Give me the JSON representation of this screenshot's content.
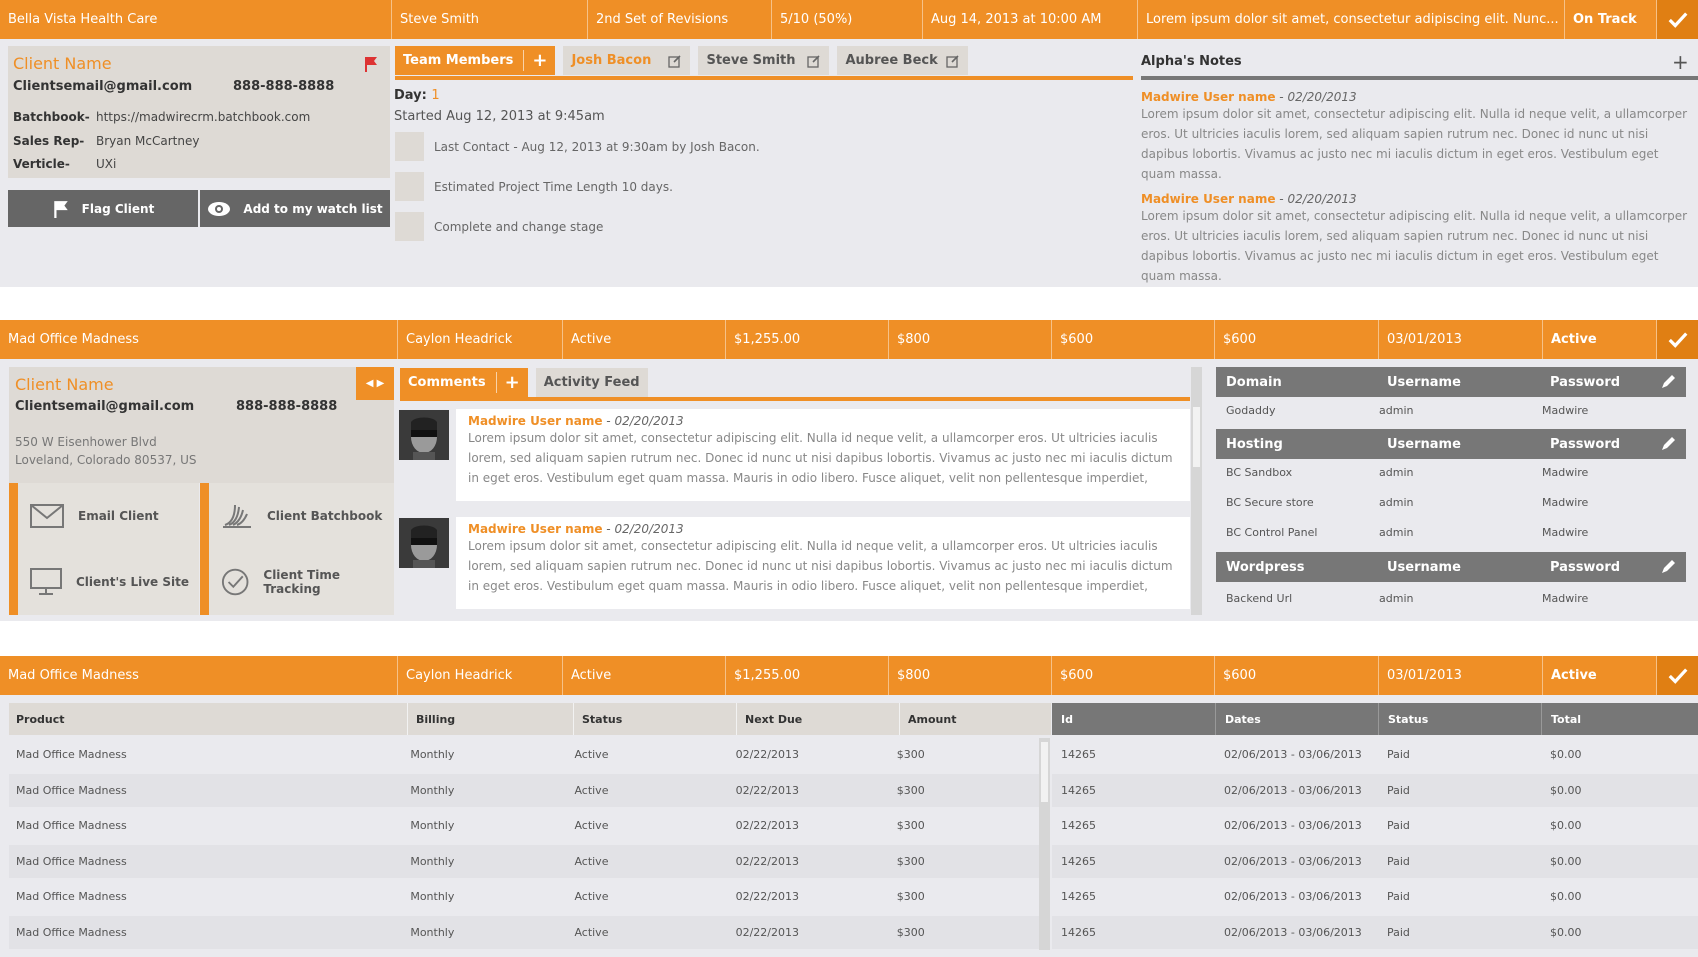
{
  "colors": {
    "accent": "#ef8f26",
    "accent_dark": "#e07f13",
    "dark_gray": "#777777",
    "panel": "#eaeaee",
    "card": "#dedad5"
  },
  "top_bar": {
    "client": "Bella Vista Health Care",
    "person": "Steve Smith",
    "revision": "2nd Set of Revisions",
    "progress_text": "5/10 (50%)",
    "progress": 0.5,
    "date": "Aug 14, 2013 at 10:00 AM",
    "summary": "Lorem ipsum dolor sit amet, consectetur adipiscing elit. Nunc...",
    "status": "On Track"
  },
  "client_card": {
    "name": "Client Name",
    "email": "Clientsemail@gmail.com",
    "phone": "888-888-8888",
    "batchbook_label": "Batchbook-",
    "batchbook_value": "https://madwirecrm.batchbook.com",
    "sales_label": "Sales Rep-",
    "sales_value": "Bryan McCartney",
    "verticle_label": "Verticle-",
    "verticle_value": "UXi",
    "flag_button": "Flag Client",
    "watch_button": "Add to my watch list"
  },
  "team": {
    "tab_label": "Team Members",
    "members": [
      "Josh Bacon",
      "Steve Smith",
      "Aubree Beck"
    ],
    "day_label": "Day:",
    "day_value": "1",
    "started": "Started Aug 12, 2013 at 9:45am",
    "checklist": [
      "Last Contact -  Aug 12, 2013 at 9:30am by Josh Bacon.",
      "Estimated Project Time Length 10 days.",
      "Complete and change stage"
    ]
  },
  "notes": {
    "title": "Alpha's Notes",
    "items": [
      {
        "user": "Madwire User name",
        "date": "02/20/2013",
        "body": "Lorem ipsum dolor sit amet, consectetur adipiscing elit. Nulla id neque velit, a ullamcorper eros. Ut ultricies iaculis lorem, sed aliquam sapien rutrum nec. Donec id nunc ut nisi dapibus lobortis. Vivamus ac justo nec mi iaculis dictum in eget eros. Vestibulum eget quam massa."
      },
      {
        "user": "Madwire User name",
        "date": "02/20/2013",
        "body": "Lorem ipsum dolor sit amet, consectetur adipiscing elit. Nulla id neque velit, a ullamcorper eros. Ut ultricies iaculis lorem, sed aliquam sapien rutrum nec. Donec id nunc ut nisi dapibus lobortis. Vivamus ac justo nec mi iaculis dictum in eget eros. Vestibulum eget quam massa."
      }
    ]
  },
  "project_bar": {
    "name": "Mad Office Madness",
    "person": "Caylon Headrick",
    "status": "Active",
    "v1": "$1,255.00",
    "v2": "$800",
    "v3": "$600",
    "v4": "$600",
    "date": "03/01/2013",
    "status2": "Active"
  },
  "client_card2": {
    "name": "Client Name",
    "email": "Clientsemail@gmail.com",
    "phone": "888-888-8888",
    "address1": "550 W Eisenhower Blvd",
    "address2": "Loveland, Colorado 80537, US",
    "actions": [
      "Email Client",
      "Client Batchbook",
      "Client's Live Site",
      "Client Time Tracking"
    ]
  },
  "comments": {
    "tab_comments": "Comments",
    "tab_activity": "Activity Feed",
    "items": [
      {
        "user": "Madwire User name",
        "date": "02/20/2013",
        "body": "Lorem ipsum dolor sit amet, consectetur adipiscing elit. Nulla id neque velit, a ullamcorper eros. Ut ultricies iaculis lorem, sed aliquam sapien rutrum nec. Donec id nunc ut nisi dapibus lobortis. Vivamus ac justo nec mi iaculis dictum in eget eros. Vestibulum eget quam massa. Mauris in odio libero. Fusce aliquet, velit non pellentesque imperdiet, nunc nulla"
      },
      {
        "user": "Madwire User name",
        "date": "02/20/2013",
        "body": "Lorem ipsum dolor sit amet, consectetur adipiscing elit. Nulla id neque velit, a ullamcorper eros. Ut ultricies iaculis lorem, sed aliquam sapien rutrum nec. Donec id nunc ut nisi dapibus lobortis. Vivamus ac justo nec mi iaculis dictum in eget eros. Vestibulum eget quam massa. Mauris in odio libero. Fusce aliquet, velit non pellentesque imperdiet, nunc nulla"
      }
    ]
  },
  "credentials": {
    "col_user": "Username",
    "col_pass": "Password",
    "groups": [
      {
        "name": "Domain",
        "rows": [
          [
            "Godaddy",
            "admin",
            "Madwire"
          ]
        ]
      },
      {
        "name": "Hosting",
        "rows": [
          [
            "BC Sandbox",
            "admin",
            "Madwire"
          ],
          [
            "BC Secure store",
            "admin",
            "Madwire"
          ],
          [
            "BC Control Panel",
            "admin",
            "Madwire"
          ]
        ]
      },
      {
        "name": "Wordpress",
        "rows": [
          [
            "Backend Url",
            "admin",
            "Madwire"
          ]
        ]
      }
    ]
  },
  "products": {
    "headers": [
      "Product",
      "Billing",
      "Status",
      "Next Due",
      "Amount"
    ],
    "rows": [
      [
        "Mad Office Madness",
        "Monthly",
        "Active",
        "02/22/2013",
        "$300"
      ],
      [
        "Mad Office Madness",
        "Monthly",
        "Active",
        "02/22/2013",
        "$300"
      ],
      [
        "Mad Office Madness",
        "Monthly",
        "Active",
        "02/22/2013",
        "$300"
      ],
      [
        "Mad Office Madness",
        "Monthly",
        "Active",
        "02/22/2013",
        "$300"
      ],
      [
        "Mad Office Madness",
        "Monthly",
        "Active",
        "02/22/2013",
        "$300"
      ],
      [
        "Mad Office Madness",
        "Monthly",
        "Active",
        "02/22/2013",
        "$300"
      ]
    ]
  },
  "invoices": {
    "headers": [
      "Id",
      "Dates",
      "Status",
      "Total"
    ],
    "rows": [
      [
        "14265",
        "02/06/2013 - 03/06/2013",
        "Paid",
        "$0.00"
      ],
      [
        "14265",
        "02/06/2013 - 03/06/2013",
        "Paid",
        "$0.00"
      ],
      [
        "14265",
        "02/06/2013 - 03/06/2013",
        "Paid",
        "$0.00"
      ],
      [
        "14265",
        "02/06/2013 - 03/06/2013",
        "Paid",
        "$0.00"
      ],
      [
        "14265",
        "02/06/2013 - 03/06/2013",
        "Paid",
        "$0.00"
      ],
      [
        "14265",
        "02/06/2013 - 03/06/2013",
        "Paid",
        "$0.00"
      ]
    ]
  }
}
